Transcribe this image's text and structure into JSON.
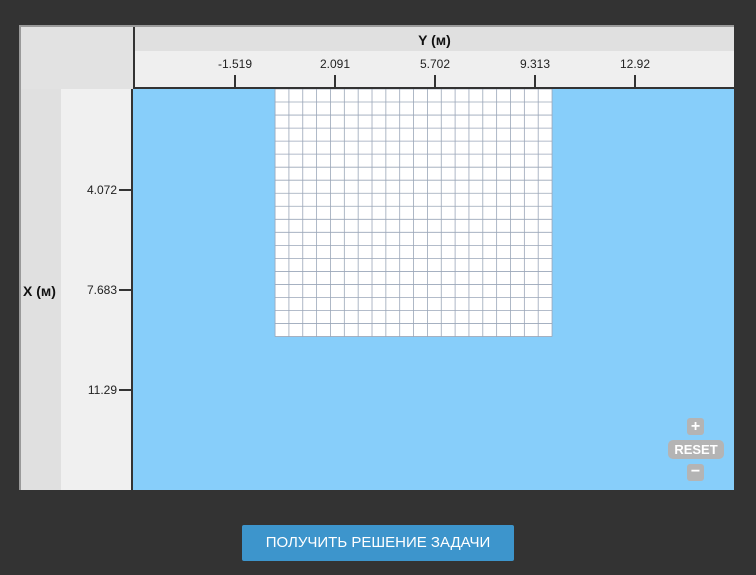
{
  "y_axis": {
    "title": "Y (м)",
    "ticks": [
      "-1.519",
      "2.091",
      "5.702",
      "9.313",
      "12.92"
    ]
  },
  "x_axis": {
    "title": "X (м)",
    "ticks": [
      "4.072",
      "7.683",
      "11.29"
    ]
  },
  "zoom": {
    "plus_label": "+",
    "reset_label": "RESET",
    "minus_label": "−"
  },
  "solve_button": "ПОЛУЧИТЬ РЕШЕНИЕ ЗАДАЧИ",
  "colors": {
    "background": "#333333",
    "plot_background": "#87cefa",
    "mesh_fill": "#ffffff",
    "mesh_line": "#9aa6b8",
    "button": "#3d95cc"
  },
  "mesh": {
    "y_start": 0.0,
    "y_end": 10.0,
    "x_start": 0.0,
    "x_end": 9.4,
    "cols": 20,
    "rows": 19
  }
}
